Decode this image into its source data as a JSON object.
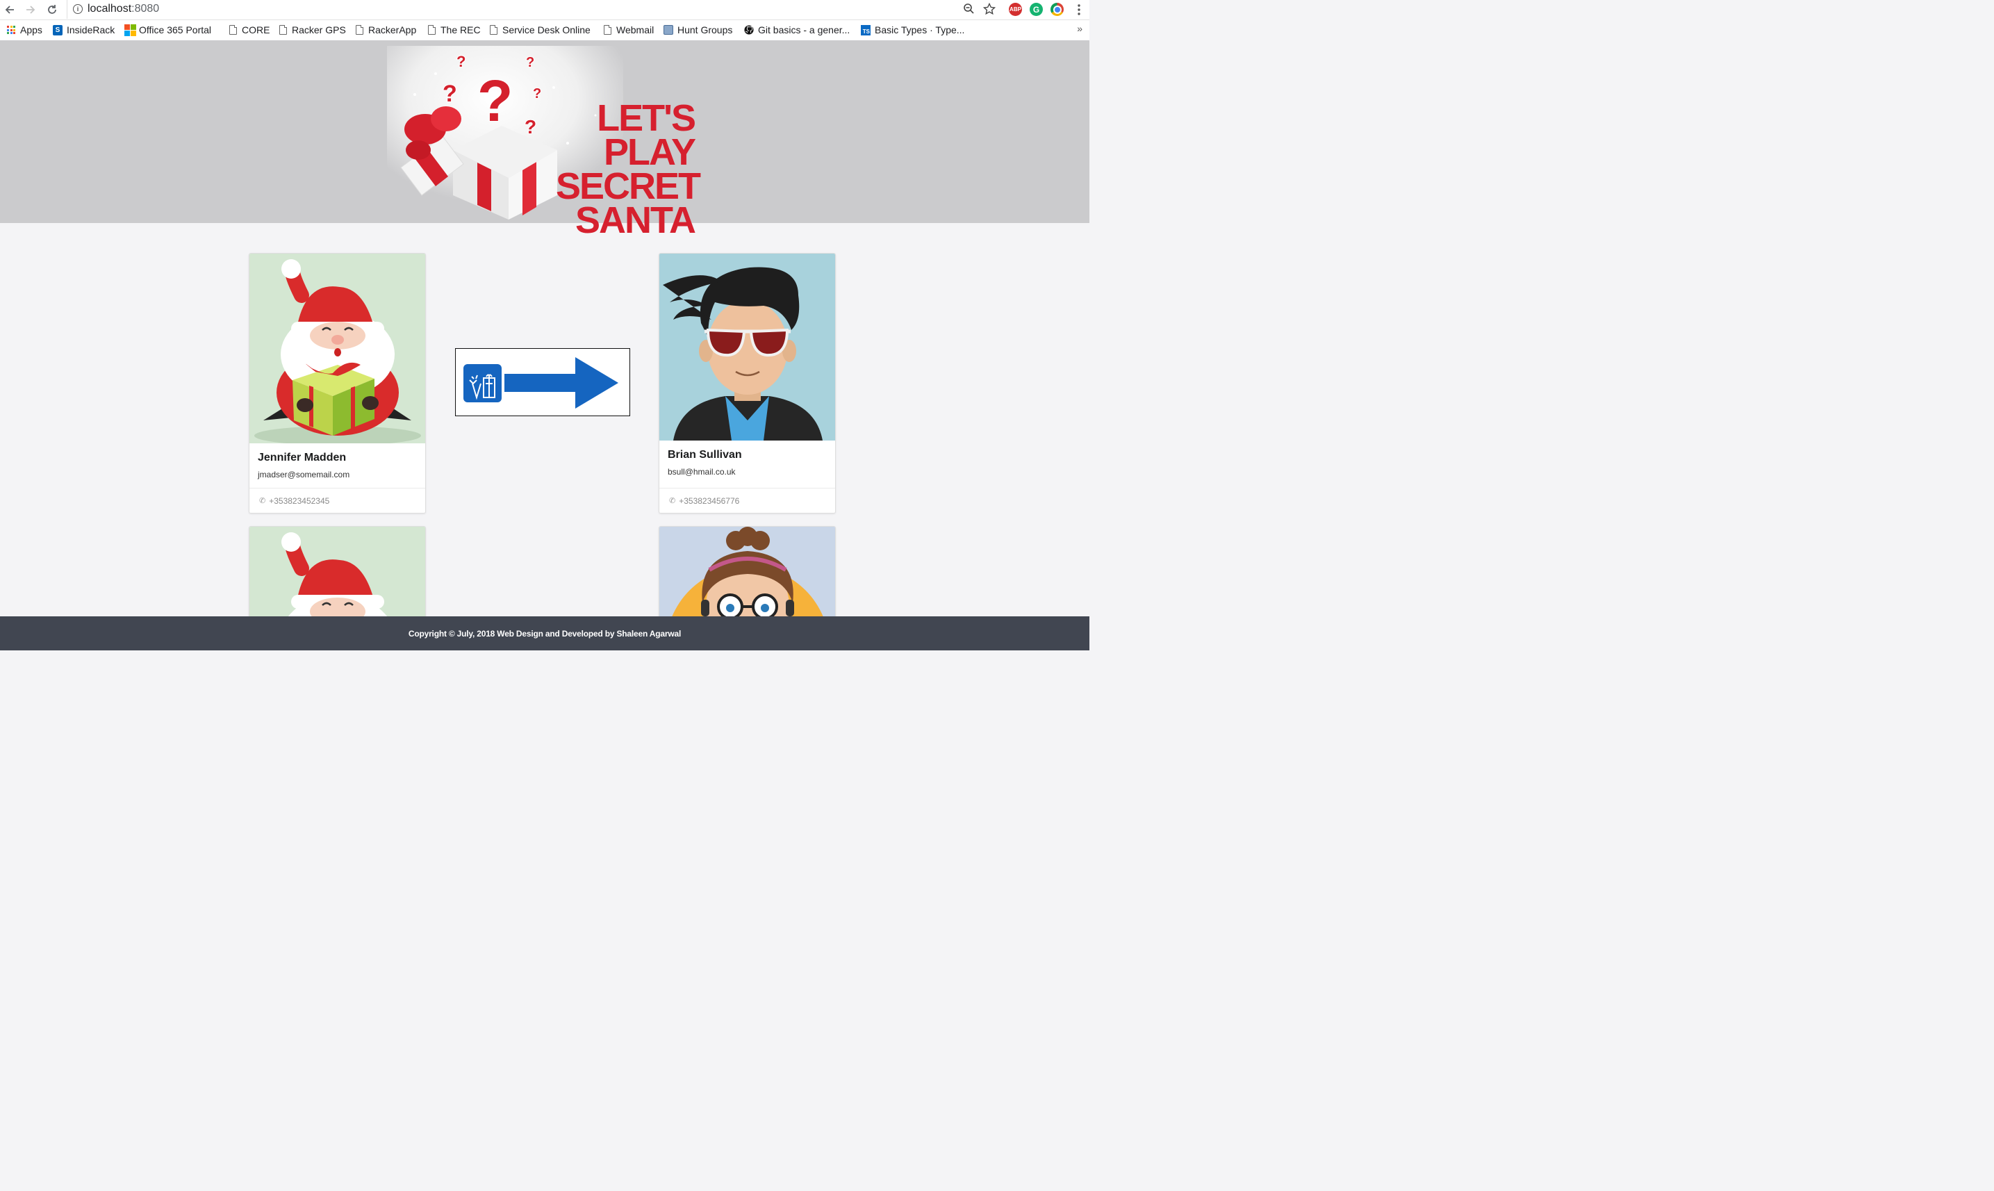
{
  "browser": {
    "url_host": "localhost",
    "url_port": ":8080",
    "bookmarks": [
      {
        "label": "Apps",
        "icon": "apps-grid-icon"
      },
      {
        "label": "InsideRack",
        "icon": "sharepoint-icon"
      },
      {
        "label": "Office 365 Portal",
        "icon": "office-icon"
      },
      {
        "label": "CORE",
        "icon": "page-icon"
      },
      {
        "label": "Racker GPS",
        "icon": "page-icon"
      },
      {
        "label": "RackerApp",
        "icon": "page-icon"
      },
      {
        "label": "The REC",
        "icon": "page-icon"
      },
      {
        "label": "Service Desk Online",
        "icon": "page-icon"
      },
      {
        "label": "Webmail",
        "icon": "page-icon"
      },
      {
        "label": "Hunt Groups",
        "icon": "phone-box-icon"
      },
      {
        "label": "Git basics - a gener...",
        "icon": "github-icon"
      },
      {
        "label": "Basic Types · Type...",
        "icon": "typescript-icon"
      }
    ],
    "more": "»",
    "ext_abp": "ABP"
  },
  "banner": {
    "line1": "LET'S",
    "line2": "PLAY",
    "line3": "SECRET",
    "line4": "SANTA"
  },
  "santa": {
    "name": "Jennifer Madden",
    "email": "jmadser@somemail.com",
    "phone": "+353823452345"
  },
  "giftee": {
    "name": "Brian Sullivan",
    "email": "bsull@hmail.co.uk",
    "phone": "+353823456776"
  },
  "footer": {
    "text": "Copyright © July, 2018 Web Design and Developed by Shaleen Agarwal"
  },
  "colors": {
    "accent_red": "#d6202e",
    "arrow_blue": "#1565c0",
    "footer_bg": "#414651"
  }
}
